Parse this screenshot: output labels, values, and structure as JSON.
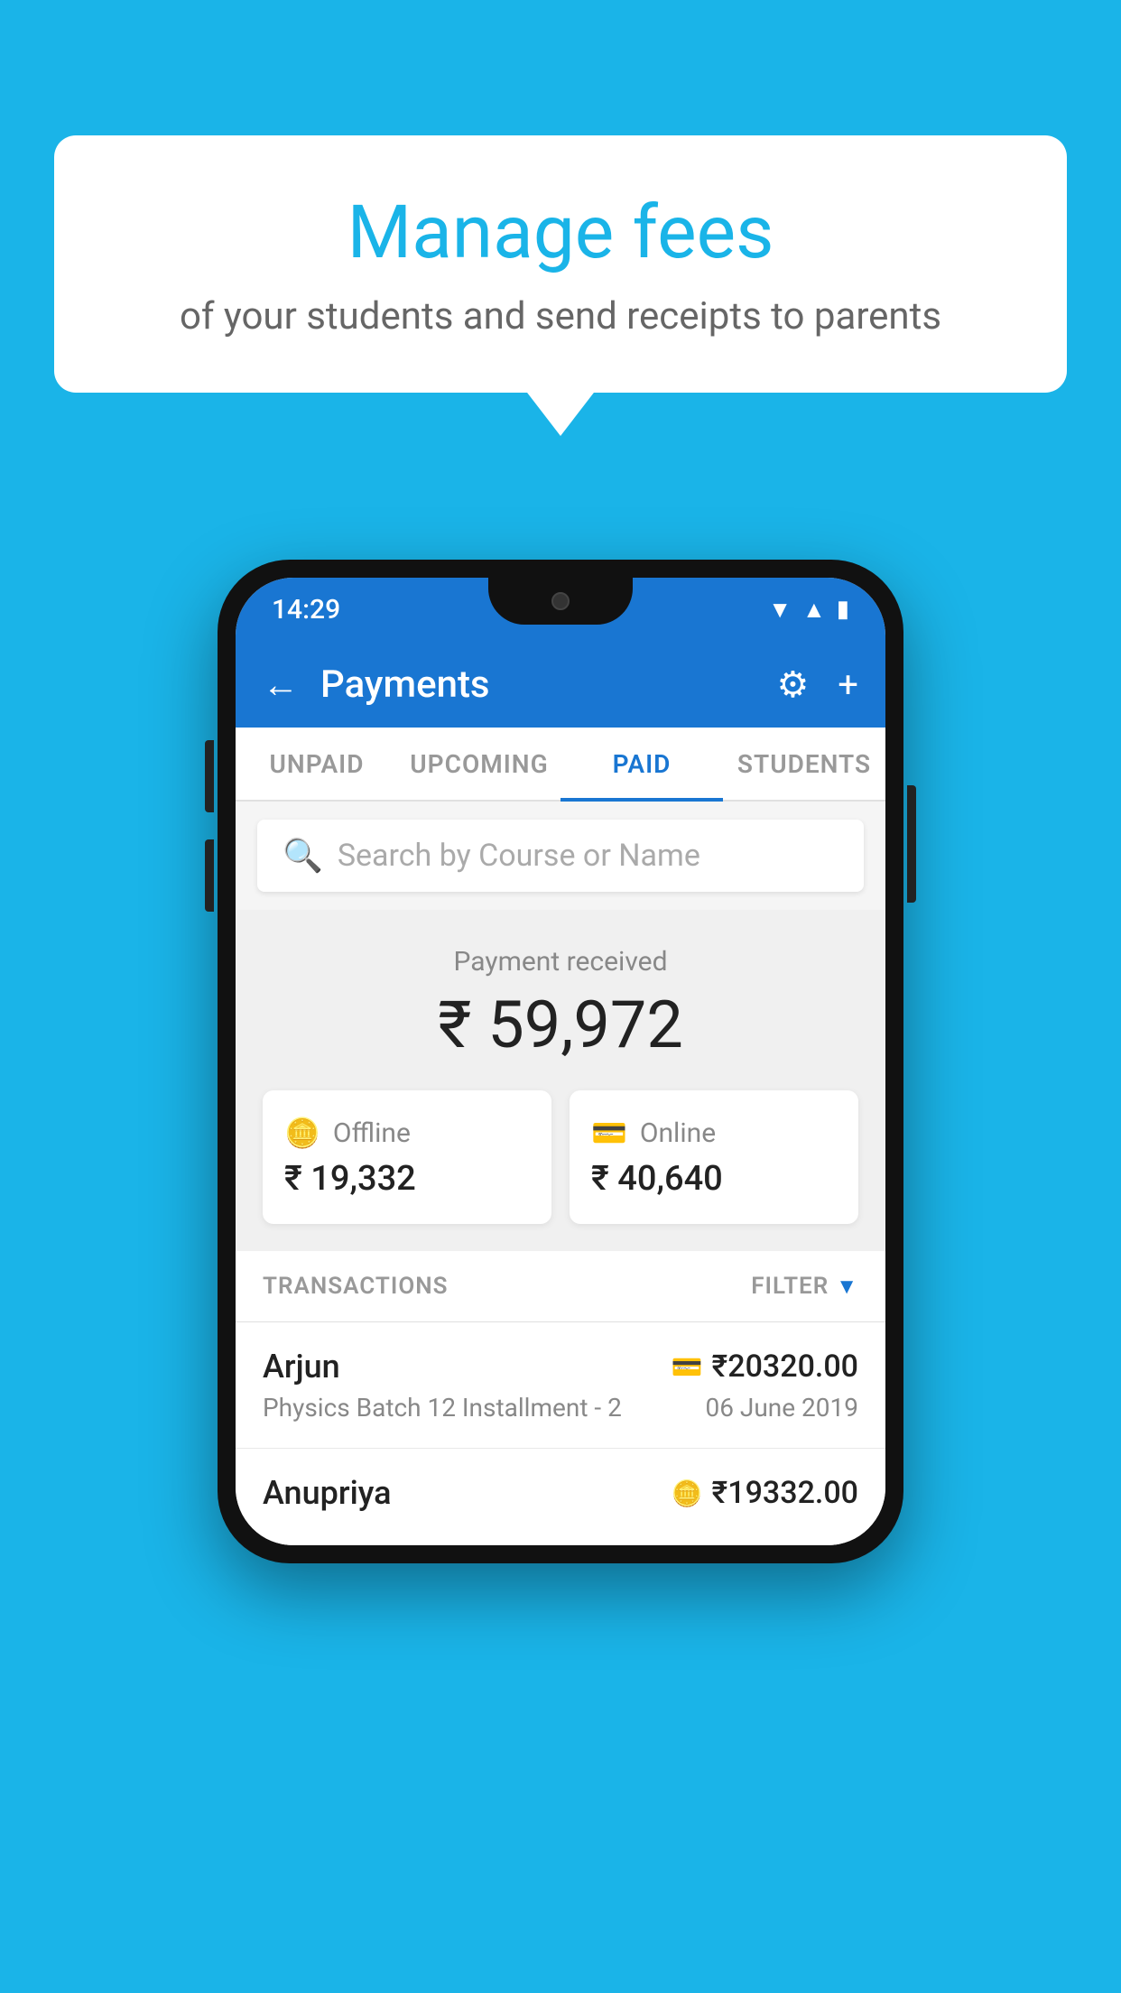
{
  "background_color": "#1ab4e8",
  "speech_bubble": {
    "title": "Manage fees",
    "subtitle": "of your students and send receipts to parents"
  },
  "status_bar": {
    "time": "14:29",
    "icons": [
      "wifi",
      "signal",
      "battery"
    ]
  },
  "app_bar": {
    "title": "Payments",
    "back_label": "←",
    "settings_label": "⚙",
    "add_label": "+"
  },
  "tabs": [
    {
      "label": "UNPAID",
      "active": false
    },
    {
      "label": "UPCOMING",
      "active": false
    },
    {
      "label": "PAID",
      "active": true
    },
    {
      "label": "STUDENTS",
      "active": false
    }
  ],
  "search": {
    "placeholder": "Search by Course or Name"
  },
  "payment_received": {
    "label": "Payment received",
    "amount": "₹ 59,972",
    "offline": {
      "type": "Offline",
      "amount": "₹ 19,332"
    },
    "online": {
      "type": "Online",
      "amount": "₹ 40,640"
    }
  },
  "transactions": {
    "header_label": "TRANSACTIONS",
    "filter_label": "FILTER",
    "rows": [
      {
        "name": "Arjun",
        "amount": "₹20320.00",
        "description": "Physics Batch 12 Installment - 2",
        "date": "06 June 2019",
        "payment_type": "card"
      },
      {
        "name": "Anupriya",
        "amount": "₹19332.00",
        "description": "",
        "date": "",
        "payment_type": "cash"
      }
    ]
  }
}
